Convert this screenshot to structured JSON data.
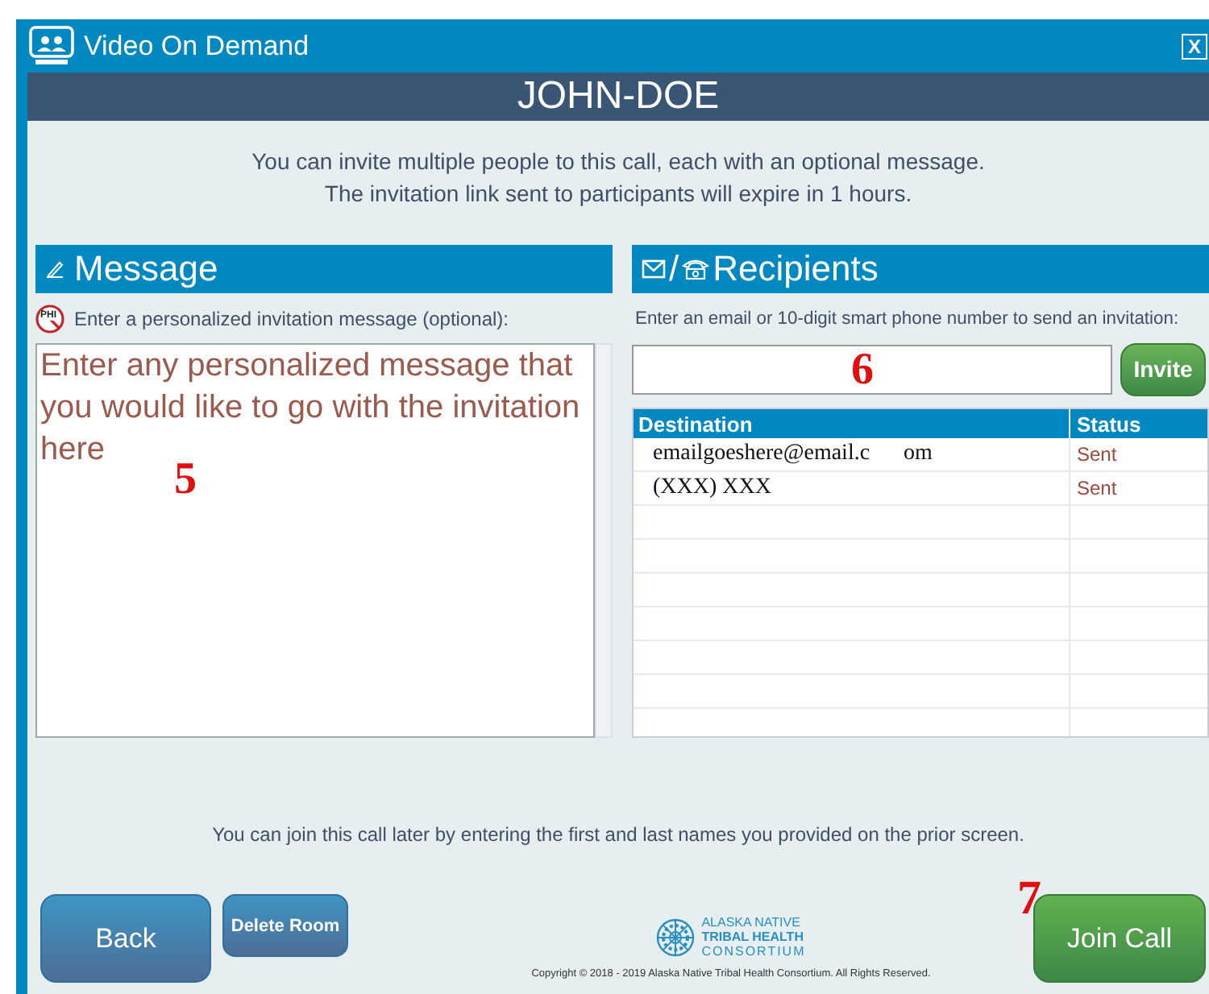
{
  "window": {
    "title": "Video On Demand",
    "close": "X"
  },
  "room_name": "JOHN-DOE",
  "intro": [
    "You can invite multiple people to this call, each with an optional message.",
    "The invitation link sent to participants will expire in 1 hours."
  ],
  "message": {
    "title": "Message",
    "phi_label": "PHI",
    "hint": "Enter a personalized invitation message (optional):",
    "placeholder": "Enter any personalized message that you would like to go with the invitation here",
    "annotation": "5"
  },
  "recipients": {
    "title": "Recipients",
    "separator": "/",
    "hint": "Enter an email or 10-digit smart phone number to send an invitation:",
    "annotation": "6",
    "invite_button": "Invite",
    "table": {
      "columns": [
        "Destination",
        "Status"
      ],
      "rows": [
        {
          "destination": "emailgoeshere@email.c      om",
          "status": "Sent"
        },
        {
          "destination": "(XXX) XXX",
          "status": "Sent"
        }
      ]
    }
  },
  "footer_note": "You can join this call later by entering the first and last names you provided on the prior screen.",
  "buttons": {
    "back": "Back",
    "delete": "Delete Room",
    "join": "Join Call",
    "join_annotation": "7"
  },
  "logo": {
    "lines": [
      "ALASKA NATIVE",
      "TRIBAL HEALTH",
      "CONSORTIUM"
    ]
  },
  "copyright": "Copyright © 2018 - 2019 Alaska Native Tribal Health Consortium. All Rights Reserved."
}
